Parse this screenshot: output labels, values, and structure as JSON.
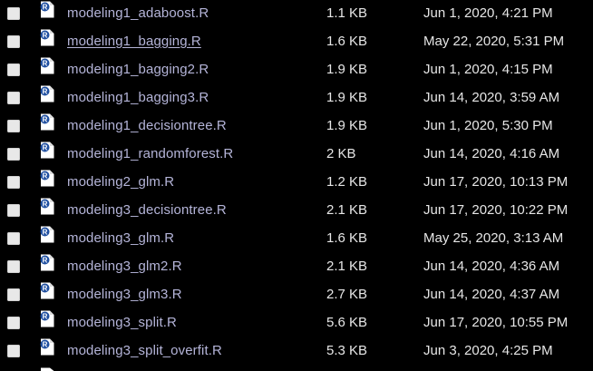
{
  "theme": {
    "background": "#000000",
    "filename_color": "#b4b4d8",
    "meta_text_color": "#e6e6e6",
    "checkbox_color": "#e8e8e8",
    "r_badge_color": "#1f4fa0"
  },
  "file_icon": {
    "name": "r-file-icon",
    "badge": "R"
  },
  "files": [
    {
      "name": "modeling1_adaboost.R",
      "size": "1.1 KB",
      "modified": "Jun 1, 2020, 4:21 PM"
    },
    {
      "name": "modeling1_bagging.R",
      "size": "1.6 KB",
      "modified": "May 22, 2020, 5:31 PM"
    },
    {
      "name": "modeling1_bagging2.R",
      "size": "1.9 KB",
      "modified": "Jun 1, 2020, 4:15 PM"
    },
    {
      "name": "modeling1_bagging3.R",
      "size": "1.9 KB",
      "modified": "Jun 14, 2020, 3:59 AM"
    },
    {
      "name": "modeling1_decisiontree.R",
      "size": "1.9 KB",
      "modified": "Jun 1, 2020, 5:30 PM"
    },
    {
      "name": "modeling1_randomforest.R",
      "size": "2 KB",
      "modified": "Jun 14, 2020, 4:16 AM"
    },
    {
      "name": "modeling2_glm.R",
      "size": "1.2 KB",
      "modified": "Jun 17, 2020, 10:13 PM"
    },
    {
      "name": "modeling3_decisiontree.R",
      "size": "2.1 KB",
      "modified": "Jun 17, 2020, 10:22 PM"
    },
    {
      "name": "modeling3_glm.R",
      "size": "1.6 KB",
      "modified": "May 25, 2020, 3:13 AM"
    },
    {
      "name": "modeling3_glm2.R",
      "size": "2.1 KB",
      "modified": "Jun 14, 2020, 4:36 AM"
    },
    {
      "name": "modeling3_glm3.R",
      "size": "2.7 KB",
      "modified": "Jun 14, 2020, 4:37 AM"
    },
    {
      "name": "modeling3_split.R",
      "size": "5.6 KB",
      "modified": "Jun 17, 2020, 10:55 PM"
    },
    {
      "name": "modeling3_split_overfit.R",
      "size": "5.3 KB",
      "modified": "Jun 3, 2020, 4:25 PM"
    }
  ]
}
